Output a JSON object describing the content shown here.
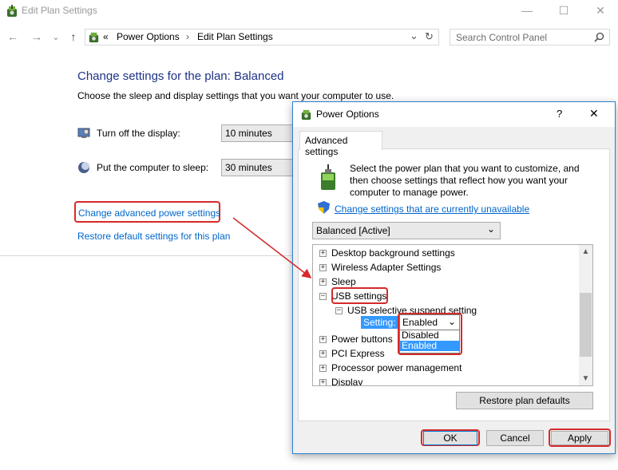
{
  "window": {
    "title": "Edit Plan Settings",
    "minimize": "—",
    "maximize": "☐",
    "close": "✕"
  },
  "nav": {
    "back": "←",
    "forward": "→",
    "recent": "⌄",
    "up": "↑",
    "path_prefix": "«",
    "crumb1": "Power Options",
    "crumb_sep": "›",
    "crumb2": "Edit Plan Settings",
    "dropdown": "⌄",
    "refresh": "↻",
    "search_placeholder": "Search Control Panel"
  },
  "page": {
    "heading": "Change settings for the plan: Balanced",
    "subheading": "Choose the sleep and display settings that you want your computer to use.",
    "display_label": "Turn off the display:",
    "display_value": "10 minutes",
    "sleep_label": "Put the computer to sleep:",
    "sleep_value": "30 minutes",
    "advanced_link": "Change advanced power settings",
    "restore_link": "Restore default settings for this plan"
  },
  "dialog": {
    "title": "Power Options",
    "help": "?",
    "close": "✕",
    "tab": "Advanced settings",
    "intro": "Select the power plan that you want to customize, and then choose settings that reflect how you want your computer to manage power.",
    "change_unavailable": "Change settings that are currently unavailable",
    "plan_value": "Balanced [Active]",
    "plan_chevron": "⌄",
    "tree": {
      "desktop_bg": "Desktop background settings",
      "wireless": "Wireless Adapter Settings",
      "sleep": "Sleep",
      "usb": "USB settings",
      "usb_suspend": "USB selective suspend setting",
      "setting_label": "Setting:",
      "setting_value": "Enabled",
      "setting_chevron": "⌄",
      "options": [
        "Disabled",
        "Enabled"
      ],
      "power_buttons": "Power buttons",
      "pci": "PCI Express",
      "processor": "Processor power management",
      "display": "Display"
    },
    "restore_defaults": "Restore plan defaults",
    "ok": "OK",
    "cancel": "Cancel",
    "apply": "Apply"
  },
  "colors": {
    "heading_blue": "#1e3287",
    "link_blue": "#0066cc",
    "highlight_red": "#d52a2a",
    "selection_blue": "#3399ff"
  }
}
